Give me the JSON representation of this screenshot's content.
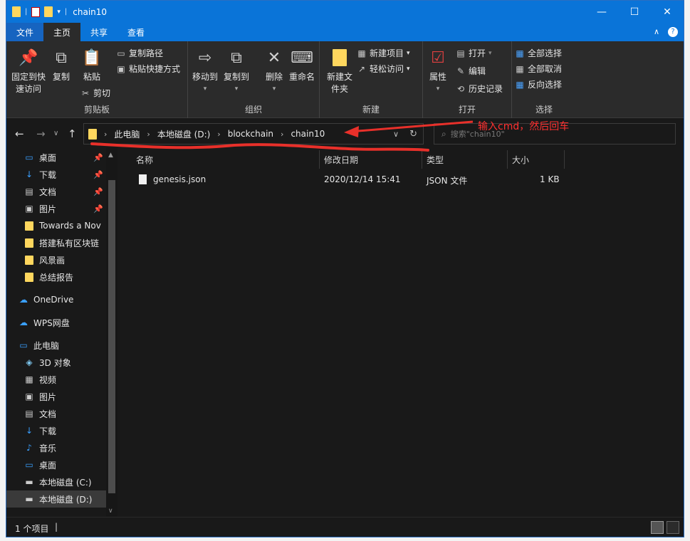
{
  "window": {
    "title": "chain10"
  },
  "menubar": {
    "file": "文件",
    "home": "主页",
    "share": "共享",
    "view": "查看"
  },
  "ribbon": {
    "clipboard": {
      "group_name": "剪贴板",
      "pin_quick_access": "固定到快速访问",
      "copy": "复制",
      "paste": "粘贴",
      "copy_path": "复制路径",
      "paste_shortcut": "粘贴快捷方式",
      "cut": "剪切"
    },
    "organize": {
      "group_name": "组织",
      "move_to": "移动到",
      "copy_to": "复制到",
      "delete": "删除",
      "rename": "重命名"
    },
    "new": {
      "group_name": "新建",
      "new_folder": "新建文件夹",
      "new_item": "新建项目",
      "easy_access": "轻松访问"
    },
    "open": {
      "group_name": "打开",
      "properties": "属性",
      "open": "打开",
      "edit": "编辑",
      "history": "历史记录"
    },
    "select": {
      "group_name": "选择",
      "select_all": "全部选择",
      "select_none": "全部取消",
      "invert": "反向选择"
    }
  },
  "address": {
    "segments": [
      "此电脑",
      "本地磁盘 (D:)",
      "blockchain",
      "chain10"
    ]
  },
  "search": {
    "placeholder": "搜索\"chain10\""
  },
  "annotation": {
    "text": "输入cmd，然后回车",
    "color": "#ff3030"
  },
  "sidebar": {
    "items": [
      {
        "label": "桌面",
        "icon": "desktop-icon",
        "pinned": true
      },
      {
        "label": "下载",
        "icon": "download-icon",
        "pinned": true
      },
      {
        "label": "文档",
        "icon": "document-icon",
        "pinned": true
      },
      {
        "label": "图片",
        "icon": "picture-icon",
        "pinned": true
      },
      {
        "label": "Towards a Nov",
        "icon": "folder-icon",
        "pinned": false
      },
      {
        "label": "搭建私有区块链",
        "icon": "folder-icon",
        "pinned": false
      },
      {
        "label": "风景画",
        "icon": "folder-icon",
        "pinned": false
      },
      {
        "label": "总结报告",
        "icon": "folder-icon",
        "pinned": false
      },
      {
        "label": "OneDrive",
        "icon": "cloud-icon",
        "pinned": false
      },
      {
        "label": "WPS网盘",
        "icon": "cloud-icon",
        "pinned": false
      },
      {
        "label": "此电脑",
        "icon": "computer-icon",
        "pinned": false
      },
      {
        "label": "3D 对象",
        "icon": "cube-icon",
        "pinned": false
      },
      {
        "label": "视频",
        "icon": "video-icon",
        "pinned": false
      },
      {
        "label": "图片",
        "icon": "picture-icon",
        "pinned": false
      },
      {
        "label": "文档",
        "icon": "document-icon",
        "pinned": false
      },
      {
        "label": "下载",
        "icon": "download-icon",
        "pinned": false
      },
      {
        "label": "音乐",
        "icon": "music-icon",
        "pinned": false
      },
      {
        "label": "桌面",
        "icon": "desktop-icon",
        "pinned": false
      },
      {
        "label": "本地磁盘 (C:)",
        "icon": "drive-icon",
        "pinned": false
      },
      {
        "label": "本地磁盘 (D:)",
        "icon": "drive-icon",
        "pinned": false,
        "selected": true
      }
    ]
  },
  "columns": {
    "name": "名称",
    "modified": "修改日期",
    "type": "类型",
    "size": "大小"
  },
  "files": [
    {
      "name": "genesis.json",
      "modified": "2020/12/14 15:41",
      "type": "JSON 文件",
      "size": "1 KB"
    }
  ],
  "status": {
    "count": "1 个项目"
  }
}
